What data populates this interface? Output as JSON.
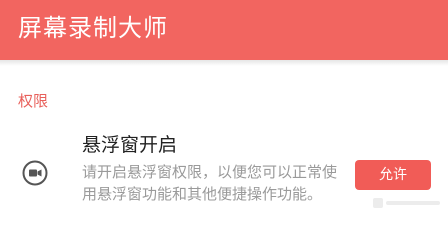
{
  "appbar": {
    "title": "屏幕录制大师",
    "background_color": "#f26560"
  },
  "section": {
    "title": "权限",
    "color": "#e8605b"
  },
  "permission": {
    "icon": "video-camera-icon",
    "title": "悬浮窗开启",
    "description": "请开启悬浮窗权限，以便您可以正常使用悬浮窗功能和其他便捷操作功能。",
    "button_label": "允许",
    "button_color": "#f15c57"
  }
}
